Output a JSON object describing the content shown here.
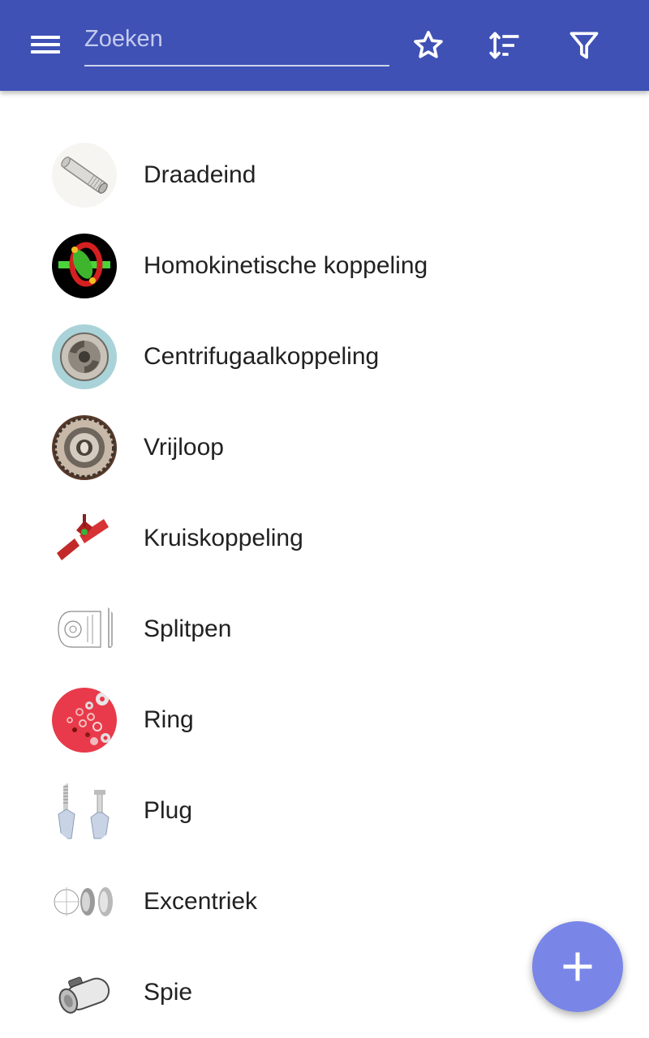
{
  "search": {
    "placeholder": "Zoeken",
    "value": ""
  },
  "toolbar": {
    "menu_icon": "menu-icon",
    "favorites_icon": "star-outline-icon",
    "sort_icon": "sort-icon",
    "filter_icon": "filter-icon"
  },
  "items": [
    {
      "label": "Draadeind",
      "icon": "threaded-rod-image"
    },
    {
      "label": "Homokinetische koppeling",
      "icon": "cv-joint-image"
    },
    {
      "label": "Centrifugaalkoppeling",
      "icon": "centrifugal-clutch-image"
    },
    {
      "label": "Vrijloop",
      "icon": "freewheel-image"
    },
    {
      "label": "Kruiskoppeling",
      "icon": "universal-joint-image"
    },
    {
      "label": "Splitpen",
      "icon": "cotter-pin-image"
    },
    {
      "label": "Ring",
      "icon": "washers-image"
    },
    {
      "label": "Plug",
      "icon": "wall-plug-image"
    },
    {
      "label": "Excentriek",
      "icon": "eccentric-image"
    },
    {
      "label": "Spie",
      "icon": "key-image"
    }
  ],
  "fab": {
    "icon": "plus-icon"
  },
  "colors": {
    "primary": "#3f51b5",
    "accent": "#7986e8",
    "text": "#212121"
  }
}
